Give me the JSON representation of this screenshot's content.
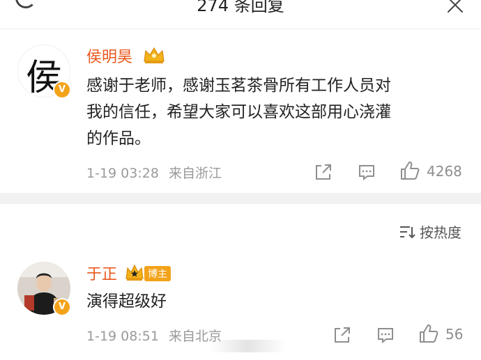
{
  "header": {
    "title": "274 条回复"
  },
  "comments": [
    {
      "avatar_char": "侯",
      "name": "侯明昊",
      "text_lines": [
        "感谢于老师，感谢玉茗茶骨所有工作人员对",
        "我的信任，希望大家可以喜欢这部用心浇灌",
        "的作品。"
      ],
      "date": "1-19 03:28",
      "location": "来自浙江",
      "likes": "4268"
    },
    {
      "name": "于正",
      "author_badge": "博主",
      "text_lines": [
        "演得超级好"
      ],
      "date": "1-19 08:51",
      "location": "来自北京",
      "likes": "56"
    }
  ],
  "sort": {
    "label": "按热度"
  },
  "colors": {
    "name": "#e8581d",
    "vip": "#f3a31a",
    "meta": "#9a9a9a",
    "separator": "#f2f2f2"
  }
}
